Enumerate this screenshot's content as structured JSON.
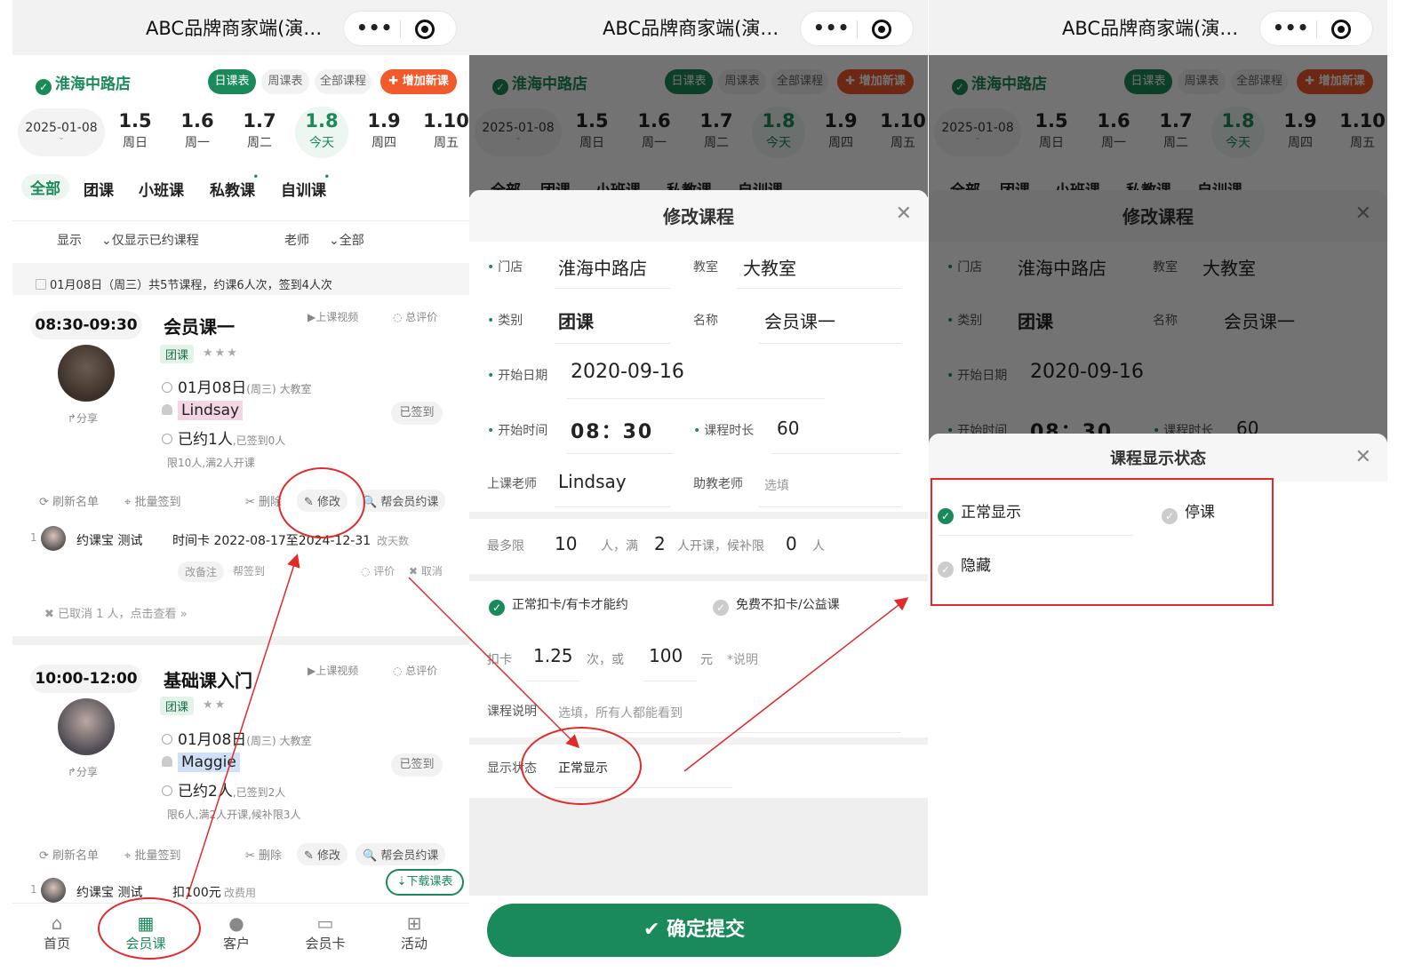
{
  "app": {
    "title": "ABC品牌商家端(演…",
    "capsule_dots": "•••"
  },
  "store": {
    "name": "淮海中路店"
  },
  "view_tabs": [
    "日课表",
    "周课表",
    "全部课程",
    "✚ 增加新课"
  ],
  "date": {
    "current": "2025-01-08",
    "chevron": "⌄"
  },
  "days": [
    {
      "num": "1.5",
      "week": "周日"
    },
    {
      "num": "1.6",
      "week": "周一"
    },
    {
      "num": "1.7",
      "week": "周二"
    },
    {
      "num": "1.8",
      "week": "今天"
    },
    {
      "num": "1.9",
      "week": "周四"
    },
    {
      "num": "1.10",
      "week": "周五"
    }
  ],
  "categories": [
    "全部",
    "团课",
    "小班课",
    "私教课",
    "自训课"
  ],
  "filters": {
    "show_label": "显示",
    "show_value": "⌄仅显示已约课程",
    "teacher_label": "老师",
    "teacher_value": "⌄全部"
  },
  "summary": "01月08日（周三）共5节课程，约课6人次，签到4人次",
  "classes": [
    {
      "time": "08:30-09:30",
      "name": "会员课一",
      "video": "▶上课视频",
      "review": "◌ 总评价",
      "tag": "团课",
      "stars": "★★★",
      "date": "01月08日",
      "date_sub": "(周三) 大教室",
      "teacher": "Lindsay",
      "signed": "已签到",
      "booked": "已约1人",
      "booked_sub": ",已签到0人",
      "limit": "限10人,满2人开课",
      "share": "↱分享",
      "actions": [
        "⟳ 刷新名单",
        "⌖ 批量签到",
        "✂ 删除",
        "✎ 修改",
        "🔍 帮会员约课"
      ],
      "member": {
        "idx": "1",
        "name": "约课宝 测试",
        "detail": "时间卡 2022-08-17至2024-12-31",
        "detail_sub": "改天数",
        "note": "改备注",
        "help": "帮签到",
        "eval": "◌ 评价",
        "cancel": "✖ 取消"
      },
      "cancelled": "✖ 已取消 1 人，点击查看 »"
    },
    {
      "time": "10:00-12:00",
      "name": "基础课入门",
      "video": "▶上课视频",
      "review": "◌ 总评价",
      "tag": "团课",
      "stars": "★★",
      "date": "01月08日",
      "date_sub": "(周三) 大教室",
      "teacher": "Maggie",
      "signed": "已签到",
      "booked": "已约2人",
      "booked_sub": ",已签到2人",
      "limit": "限6人,满2人开课,候补限3人",
      "share": "↱分享",
      "actions": [
        "⟳ 刷新名单",
        "⌖ 批量签到",
        "✂ 删除",
        "✎ 修改",
        "🔍 帮会员约课"
      ],
      "member": {
        "idx": "1",
        "name": "约课宝 测试",
        "detail": "扣100元",
        "detail_sub": "改费用"
      },
      "download": "⇣下载课表"
    }
  ],
  "nav": [
    {
      "icon": "⌂",
      "label": "首页"
    },
    {
      "icon": "▦",
      "label": "会员课"
    },
    {
      "icon": "●",
      "label": "客户"
    },
    {
      "icon": "▭",
      "label": "会员卡"
    },
    {
      "icon": "⊞",
      "label": "活动"
    }
  ],
  "edit_form": {
    "title": "修改课程",
    "close": "✕",
    "store_label": "门店",
    "store_value": "淮海中路店",
    "room_label": "教室",
    "room_value": "大教室",
    "type_label": "类别",
    "type_value": "团课",
    "name_label": "名称",
    "name_value": "会员课一",
    "start_date_label": "开始日期",
    "start_date_value": "2020-09-16",
    "start_time_label": "开始时间",
    "start_time_value": "08：30",
    "duration_label": "课程时长",
    "duration_value": "60",
    "teacher_label": "上课老师",
    "teacher_value": "Lindsay",
    "assistant_label": "助教老师",
    "assistant_placeholder": "选填",
    "max_label": "最多限",
    "max_value": "10",
    "max_unit": "人，满",
    "min_value": "2",
    "min_unit": "人开课，候补限",
    "wait_value": "0",
    "wait_unit": "人",
    "opt_normal": "正常扣卡/有卡才能约",
    "opt_free": "免费不扣卡/公益课",
    "deduct_label": "扣卡",
    "deduct_times": "1.25",
    "deduct_times_unit": "次，或",
    "deduct_amount": "100",
    "deduct_amount_unit": "元",
    "deduct_note": "*说明",
    "desc_label": "课程说明",
    "desc_placeholder": "选填，所有人都能看到",
    "status_label": "显示状态",
    "status_value": "正常显示",
    "submit": "✔ 确定提交"
  },
  "status_sheet": {
    "title": "课程显示状态",
    "close": "✕",
    "options": [
      "正常显示",
      "停课",
      "隐藏"
    ]
  },
  "colors": {
    "brand": "#1b8a5a",
    "accent": "#f25a2b",
    "annotation": "#e02b2b"
  }
}
